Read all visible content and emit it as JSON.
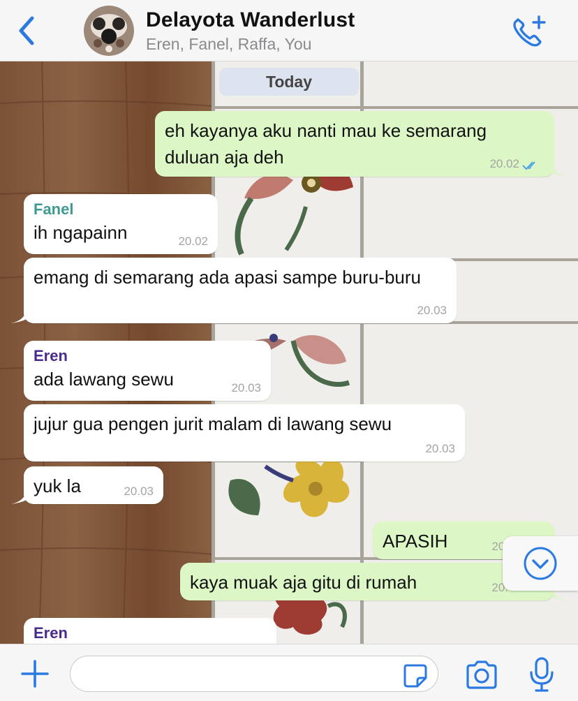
{
  "header": {
    "title": "Delayota Wanderlust",
    "participants": "Eren, Fanel, Raffa, You",
    "icons": {
      "back": "chevron-left-icon",
      "call": "add-call-icon"
    }
  },
  "chat": {
    "date_label": "Today",
    "messages": [
      {
        "direction": "out",
        "text": "eh kayanya aku nanti mau ke semarang duluan aja deh",
        "time": "20.02",
        "read": true
      },
      {
        "direction": "in",
        "sender": "Fanel",
        "text": "ih ngapainn",
        "time": "20.02"
      },
      {
        "direction": "in",
        "text": "emang di semarang ada apasi sampe buru-buru",
        "time": "20.03"
      },
      {
        "direction": "in",
        "sender": "Eren",
        "text": "ada lawang sewu",
        "time": "20.03"
      },
      {
        "direction": "in",
        "text": "jujur gua pengen jurit malam di lawang sewu",
        "time": "20.03"
      },
      {
        "direction": "in",
        "text": "yuk la",
        "time": "20.03"
      },
      {
        "direction": "out",
        "text": "APASIH",
        "time": "20."
      },
      {
        "direction": "out",
        "text": "kaya muak aja gitu di rumah",
        "time": "20."
      },
      {
        "direction": "in",
        "sender": "Eren",
        "text": ""
      }
    ],
    "sender_colors": {
      "Fanel": "#3d9a93",
      "Eren": "#4a2a8c"
    }
  },
  "input": {
    "placeholder": "",
    "value": ""
  },
  "colors": {
    "accent": "#2a7ae2",
    "outgoing": "#dcf7c5",
    "incoming": "#ffffff",
    "read_ticks": "#4fa3e8"
  }
}
